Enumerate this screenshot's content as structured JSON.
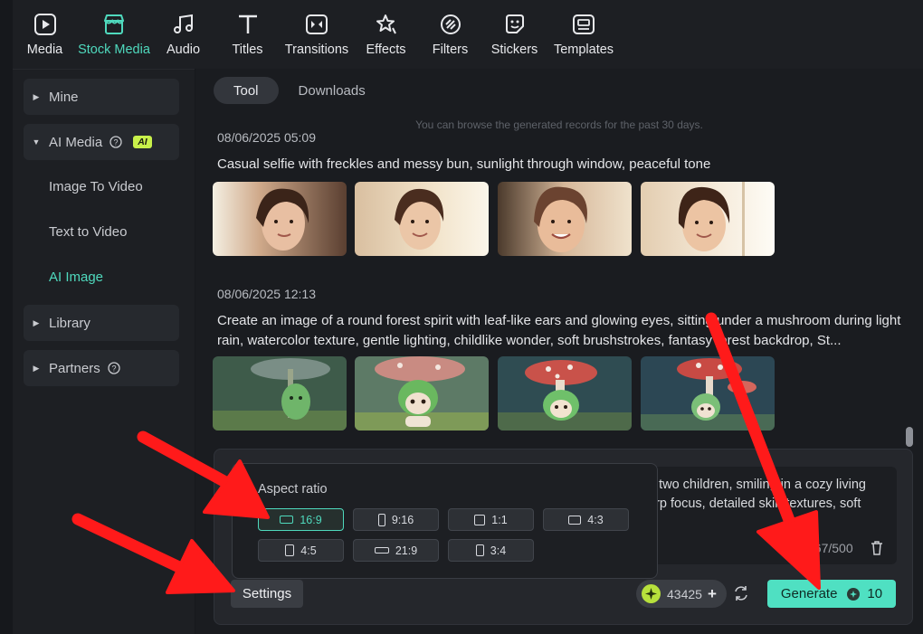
{
  "toolbar": {
    "items": [
      {
        "label": "Media",
        "icon": "media-icon"
      },
      {
        "label": "Stock Media",
        "icon": "stock-media-icon",
        "active": true
      },
      {
        "label": "Audio",
        "icon": "music-note-icon"
      },
      {
        "label": "Titles",
        "icon": "text-t-icon"
      },
      {
        "label": "Transitions",
        "icon": "transition-icon"
      },
      {
        "label": "Effects",
        "icon": "effects-icon"
      },
      {
        "label": "Filters",
        "icon": "filter-icon"
      },
      {
        "label": "Stickers",
        "icon": "sticker-icon"
      },
      {
        "label": "Templates",
        "icon": "template-icon"
      }
    ]
  },
  "sidebar": {
    "mine": "Mine",
    "ai_media": "AI Media",
    "ai_badge": "AI",
    "sub_items": [
      "Image To Video",
      "Text to Video",
      "AI Image"
    ],
    "library": "Library",
    "partners": "Partners"
  },
  "tabs": {
    "tool": "Tool",
    "downloads": "Downloads"
  },
  "records": {
    "info": "You can browse the generated records for the past 30 days.",
    "items": [
      {
        "date": "08/06/2025 05:09",
        "prompt": "Casual selfie with freckles and messy bun, sunlight through window, peaceful tone"
      },
      {
        "date": "08/06/2025 12:13",
        "prompt": "Create an image of a round forest spirit with leaf-like ears and glowing eyes, sitting under a mushroom during light rain, watercolor texture, gentle lighting, childlike wonder, soft brushstrokes, fantasy forest backdrop, St..."
      }
    ]
  },
  "composer": {
    "prompt_text": "d two children, smiling in a cozy living arp focus, detailed skin textures, soft",
    "counter": "267/500"
  },
  "aspect_ratio": {
    "title": "Aspect ratio",
    "options": [
      "16:9",
      "9:16",
      "1:1",
      "4:3",
      "4:5",
      "21:9",
      "3:4"
    ],
    "selected": "16:9"
  },
  "actions": {
    "settings": "Settings",
    "credits": "43425",
    "generate": "Generate",
    "generate_cost": "10"
  },
  "colors": {
    "accent": "#4fd9bd",
    "generate_bg": "#4fe0c2",
    "ai_badge": "#c8f04a",
    "annotation_arrow": "#ff1a1a"
  }
}
